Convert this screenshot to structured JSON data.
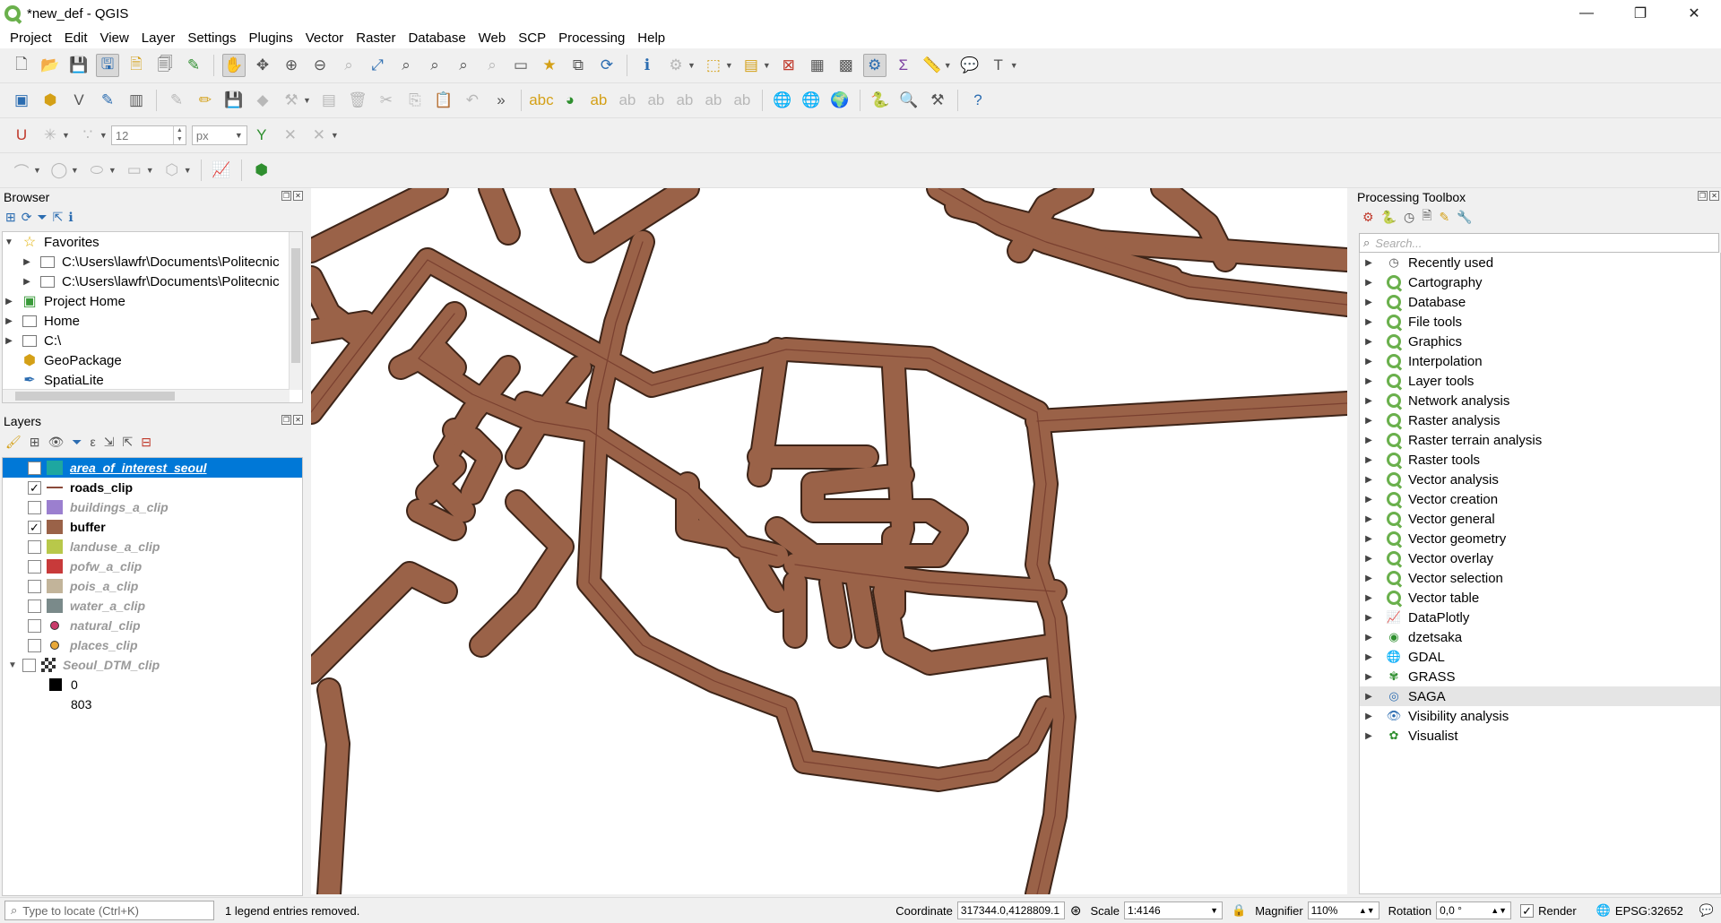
{
  "window": {
    "title": "*new_def - QGIS",
    "minimize": "—",
    "maximize": "❐",
    "close": "✕"
  },
  "menu": [
    "Project",
    "Edit",
    "View",
    "Layer",
    "Settings",
    "Plugins",
    "Vector",
    "Raster",
    "Database",
    "Web",
    "SCP",
    "Processing",
    "Help"
  ],
  "digitizing": {
    "snap_value": "12",
    "snap_unit": "px"
  },
  "browser": {
    "title": "Browser",
    "items": [
      {
        "label": "Favorites",
        "icon": "star-icon",
        "expanded": true,
        "depth": 0
      },
      {
        "label": "C:\\Users\\lawfr\\Documents\\Politecnic",
        "icon": "folder-icon",
        "depth": 1
      },
      {
        "label": "C:\\Users\\lawfr\\Documents\\Politecnic",
        "icon": "folder-icon",
        "depth": 1
      },
      {
        "label": "Project Home",
        "icon": "project-home-icon",
        "depth": 0
      },
      {
        "label": "Home",
        "icon": "folder-icon",
        "depth": 0
      },
      {
        "label": "C:\\",
        "icon": "folder-icon",
        "depth": 0
      },
      {
        "label": "GeoPackage",
        "icon": "geopackage-icon",
        "depth": 0
      },
      {
        "label": "SpatiaLite",
        "icon": "spatialite-icon",
        "depth": 0
      }
    ]
  },
  "layers": {
    "title": "Layers",
    "items": [
      {
        "label": "area_of_interest_seoul",
        "checked": false,
        "symbol": "fill",
        "color": "#1ea7a0",
        "selected": true,
        "visible": true
      },
      {
        "label": "roads_clip",
        "checked": true,
        "symbol": "line",
        "color": "#8a4a3a",
        "visible": true
      },
      {
        "label": "buildings_a_clip",
        "checked": false,
        "symbol": "fill",
        "color": "#9b7fcf",
        "visible": false
      },
      {
        "label": "buffer",
        "checked": true,
        "symbol": "fill",
        "color": "#9a6248",
        "visible": true
      },
      {
        "label": "landuse_a_clip",
        "checked": false,
        "symbol": "fill",
        "color": "#b8c84a",
        "visible": false
      },
      {
        "label": "pofw_a_clip",
        "checked": false,
        "symbol": "fill",
        "color": "#c83a3a",
        "visible": false
      },
      {
        "label": "pois_a_clip",
        "checked": false,
        "symbol": "fill",
        "color": "#c2b49a",
        "visible": false
      },
      {
        "label": "water_a_clip",
        "checked": false,
        "symbol": "fill",
        "color": "#7a8a8a",
        "visible": false
      },
      {
        "label": "natural_clip",
        "checked": false,
        "symbol": "point",
        "color": "#c83a6a",
        "visible": false
      },
      {
        "label": "places_clip",
        "checked": false,
        "symbol": "point",
        "color": "#e8a838",
        "visible": false
      },
      {
        "label": "Seoul_DTM_clip",
        "checked": false,
        "symbol": "raster",
        "color": "#333333",
        "visible": false,
        "expanded": true
      }
    ],
    "raster_legend": [
      {
        "label": "0",
        "color": "#000000"
      },
      {
        "label": "803",
        "color": "#ffffff"
      }
    ]
  },
  "processing": {
    "title": "Processing Toolbox",
    "search_placeholder": "Search...",
    "groups": [
      {
        "label": "Recently used",
        "icon": "clock-icon"
      },
      {
        "label": "Cartography",
        "icon": "qgis-icon"
      },
      {
        "label": "Database",
        "icon": "qgis-icon"
      },
      {
        "label": "File tools",
        "icon": "qgis-icon"
      },
      {
        "label": "Graphics",
        "icon": "qgis-icon"
      },
      {
        "label": "Interpolation",
        "icon": "qgis-icon"
      },
      {
        "label": "Layer tools",
        "icon": "qgis-icon"
      },
      {
        "label": "Network analysis",
        "icon": "qgis-icon"
      },
      {
        "label": "Raster analysis",
        "icon": "qgis-icon"
      },
      {
        "label": "Raster terrain analysis",
        "icon": "qgis-icon"
      },
      {
        "label": "Raster tools",
        "icon": "qgis-icon"
      },
      {
        "label": "Vector analysis",
        "icon": "qgis-icon"
      },
      {
        "label": "Vector creation",
        "icon": "qgis-icon"
      },
      {
        "label": "Vector general",
        "icon": "qgis-icon"
      },
      {
        "label": "Vector geometry",
        "icon": "qgis-icon"
      },
      {
        "label": "Vector overlay",
        "icon": "qgis-icon"
      },
      {
        "label": "Vector selection",
        "icon": "qgis-icon"
      },
      {
        "label": "Vector table",
        "icon": "qgis-icon"
      },
      {
        "label": "DataPlotly",
        "icon": "dataplotly-icon"
      },
      {
        "label": "dzetsaka",
        "icon": "dzetsaka-icon"
      },
      {
        "label": "GDAL",
        "icon": "gdal-icon"
      },
      {
        "label": "GRASS",
        "icon": "grass-icon"
      },
      {
        "label": "SAGA",
        "icon": "saga-icon",
        "highlighted": true
      },
      {
        "label": "Visibility analysis",
        "icon": "eye-icon"
      },
      {
        "label": "Visualist",
        "icon": "visualist-icon"
      }
    ]
  },
  "statusbar": {
    "locator_placeholder": "Type to locate (Ctrl+K)",
    "message": "1 legend entries removed.",
    "coordinate_label": "Coordinate",
    "coordinate": "317344.0,4128809.1",
    "scale_label": "Scale",
    "scale": "1:4146",
    "magnifier_label": "Magnifier",
    "magnifier": "110%",
    "rotation_label": "Rotation",
    "rotation": "0,0 °",
    "render_label": "Render",
    "render_checked": true,
    "crs": "EPSG:32652"
  },
  "colors": {
    "buffer_fill": "#9a6248",
    "buffer_stroke": "#3d2418",
    "road_line": "#7a4030",
    "selection": "#0078d7"
  }
}
